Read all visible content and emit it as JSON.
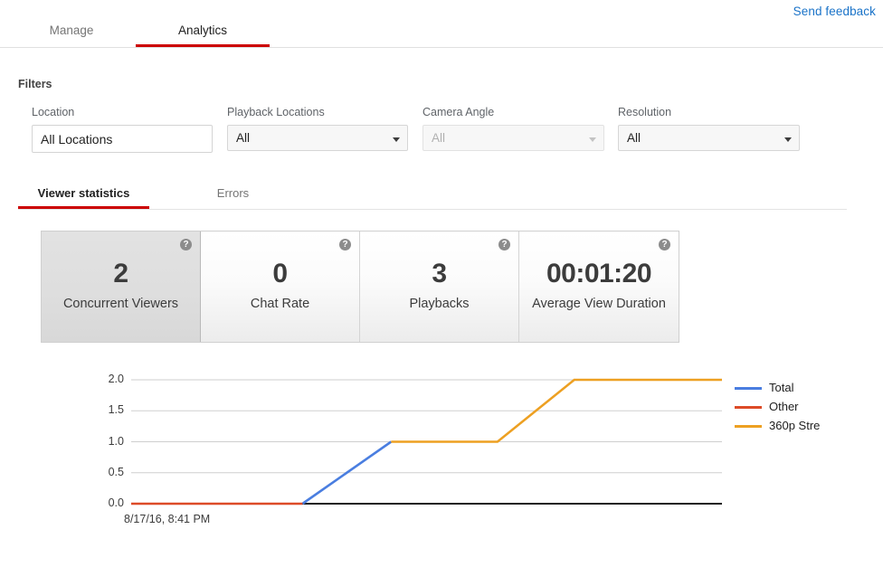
{
  "header": {
    "feedback_label": "Send feedback",
    "feedback_color": "#1a73c8"
  },
  "top_tabs": [
    {
      "label": "Manage",
      "active": false
    },
    {
      "label": "Analytics",
      "active": true
    }
  ],
  "filters": {
    "title": "Filters",
    "items": [
      {
        "label": "Location",
        "value": "All Locations",
        "type": "text",
        "disabled": false
      },
      {
        "label": "Playback Locations",
        "value": "All",
        "type": "select",
        "disabled": false
      },
      {
        "label": "Camera Angle",
        "value": "All",
        "type": "select",
        "disabled": true
      },
      {
        "label": "Resolution",
        "value": "All",
        "type": "select",
        "disabled": false
      }
    ]
  },
  "sub_tabs": [
    {
      "label": "Viewer statistics",
      "active": true
    },
    {
      "label": "Errors",
      "active": false
    }
  ],
  "cards": [
    {
      "value": "2",
      "label": "Concurrent Viewers",
      "help": "?",
      "selected": true
    },
    {
      "value": "0",
      "label": "Chat Rate",
      "help": "?",
      "selected": false
    },
    {
      "value": "3",
      "label": "Playbacks",
      "help": "?",
      "selected": false
    },
    {
      "value": "00:01:20",
      "label": "Average View Duration",
      "help": "?",
      "selected": false
    }
  ],
  "chart_data": {
    "type": "line",
    "title": "",
    "xlabel": "",
    "ylabel": "",
    "ylim": [
      0.0,
      2.0
    ],
    "yticks": [
      "0.0",
      "0.5",
      "1.0",
      "1.5",
      "2.0"
    ],
    "ytick_values": [
      0.0,
      0.5,
      1.0,
      1.5,
      2.0
    ],
    "xticks": [
      "8/17/16, 8:41 PM"
    ],
    "grid": true,
    "legend_position": "right",
    "series": [
      {
        "name": "Total",
        "color": "#4a7ee0",
        "points": [
          [
            0.29,
            0.0
          ],
          [
            0.44,
            1.0
          ]
        ]
      },
      {
        "name": "Other",
        "color": "#dd4b28",
        "points": [
          [
            0.0,
            0.0
          ],
          [
            0.29,
            0.0
          ]
        ]
      },
      {
        "name": "360p Stre",
        "color": "#eda022",
        "points": [
          [
            0.44,
            1.0
          ],
          [
            0.62,
            1.0
          ],
          [
            0.75,
            2.0
          ],
          [
            1.0,
            2.0
          ]
        ]
      }
    ]
  }
}
